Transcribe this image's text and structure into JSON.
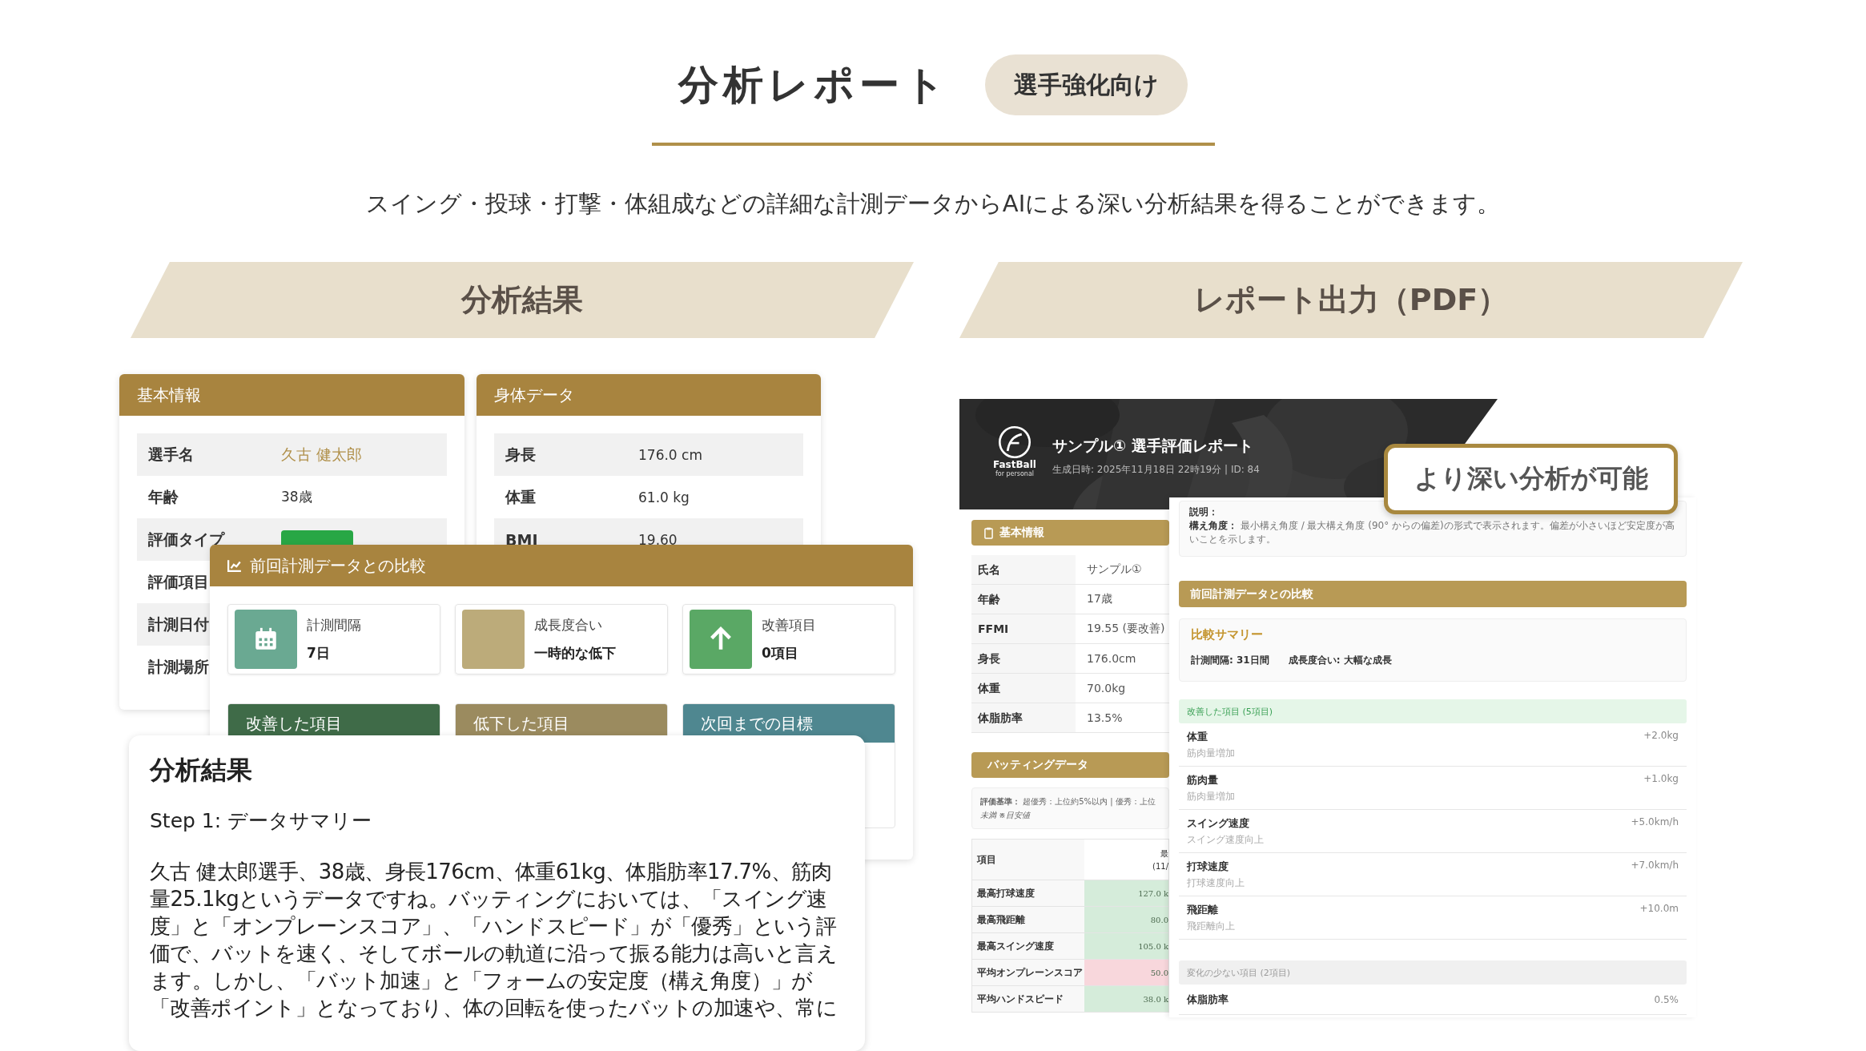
{
  "header": {
    "title": "分析レポート",
    "badge": "選手強化向け"
  },
  "subtitle": "スイング・投球・打撃・体組成などの詳細な計測データからAIによる深い分析結果を得ることができます。",
  "sections": [
    {
      "title": "分析結果"
    },
    {
      "title": "レポート出力（PDF）"
    }
  ],
  "analysis_screen": {
    "basic_info": {
      "title": "基本情報",
      "rows": [
        {
          "label": "選手名",
          "value": "久古 健太郎",
          "kind": "accent"
        },
        {
          "label": "年齢",
          "value": "38歳",
          "kind": "text"
        },
        {
          "label": "評価タイプ",
          "kind": "tag"
        },
        {
          "label": "評価項目",
          "kind": "text"
        },
        {
          "label": "計測日付",
          "kind": "text"
        },
        {
          "label": "計測場所",
          "kind": "text"
        }
      ]
    },
    "body_data": {
      "title": "身体データ",
      "rows": [
        {
          "label": "身長",
          "value": "176.0 cm"
        },
        {
          "label": "体重",
          "value": "61.0 kg"
        },
        {
          "label": "BMI",
          "value": "19.60"
        }
      ]
    },
    "comparison": {
      "title": "前回計測データとの比較",
      "stats": [
        {
          "label": "計測間隔",
          "value": "7日",
          "kind": "calendar",
          "color": "#6aa992"
        },
        {
          "label": "成長度合い",
          "value": "一時的な低下",
          "kind": "blank",
          "color": "#bcab7a"
        },
        {
          "label": "改善項目",
          "value": "0項目",
          "kind": "arrow-up",
          "color": "#5aa865"
        }
      ],
      "columns": [
        {
          "title": "改善した項目",
          "color": "#3f6b48"
        },
        {
          "title": "低下した項目",
          "color": "#9b8b5f"
        },
        {
          "title": "次回までの目標",
          "color": "#4f8790"
        }
      ]
    },
    "result": {
      "title": "分析結果",
      "step": "Step 1: データサマリー",
      "body": "久古 健太郎選手、38歳、身長176cm、体重61kg、体脂肪率17.7%、筋肉量25.1kgというデータですね。バッティングにおいては、「スイング速度」と「オンプレーンスコア」、「ハンドスピード」が「優秀」という評価で、バットを速く、そしてボールの軌道に沿って振る能力は高いと言えます。しかし、「バット加速」と「フォームの安定度（構え角度）」が「改善ポイント」となっており、体の回転を使ったバットの加速や、常に"
    }
  },
  "report_pdf": {
    "header": {
      "logo_name": "FastBall",
      "logo_sub": "for personal",
      "title": "サンプル① 選手評価レポート",
      "meta": "生成日時: 2025年11月18日 22時19分 | ID: 84"
    },
    "basic_info": {
      "title": "基本情報",
      "rows": [
        {
          "label": "氏名",
          "value": "サンプル①"
        },
        {
          "label": "年齢",
          "value": "17歳"
        },
        {
          "label": "FFMI",
          "value": "19.55 (要改善)"
        },
        {
          "label": "身長",
          "value": "176.0cm"
        },
        {
          "label": "体重",
          "value": "70.0kg"
        },
        {
          "label": "体脂肪率",
          "value": "13.5%"
        }
      ]
    },
    "batting": {
      "title": "バッティングデータ",
      "criteria": "**評価基準：** 超優秀：上位約5%以内 | 優秀：上位",
      "criteria_note": "未満 ※目安値",
      "columns": [
        {
          "label": "項目"
        },
        {
          "label": "最",
          "sub": "(11/"
        }
      ],
      "rows": [
        {
          "item": "最高打球速度",
          "value": "127.0 k",
          "color": "#d5ecda"
        },
        {
          "item": "最高飛距離",
          "value": "80.0",
          "color": "#d5ecda"
        },
        {
          "item": "最高スイング速度",
          "value": "105.0 k",
          "color": "#d5ecda"
        },
        {
          "item": "平均オンプレーンスコア",
          "value": "50.0",
          "color": "#f8d7dc"
        },
        {
          "item": "平均ハンドスピード",
          "value": "38.0 k",
          "color": "#d5ecda"
        }
      ]
    },
    "note": {
      "label": "説明：",
      "text": "**構え角度：** 最小構え角度 / 最大構え角度 (90° からの偏差)の形式で表示されます。偏差が小さいほど安定度が高いことを示します。"
    },
    "comparison": {
      "title": "前回計測データとの比較",
      "summary_title": "比較サマリー",
      "interval": "計測間隔: 31日間",
      "growth": "成長度合い: 大幅な成長",
      "improved_title": "改善した項目 (5項目)",
      "improved": [
        {
          "name": "体重",
          "value": "+2.0kg",
          "desc": "筋肉量増加"
        },
        {
          "name": "筋肉量",
          "value": "+1.0kg",
          "desc": "筋肉量増加"
        },
        {
          "name": "スイング速度",
          "value": "+5.0km/h",
          "desc": "スイング速度向上"
        },
        {
          "name": "打球速度",
          "value": "+7.0km/h",
          "desc": "打球速度向上"
        },
        {
          "name": "飛距離",
          "value": "+10.0m",
          "desc": "飛距離向上"
        }
      ],
      "stable_title": "変化の少ない項目 (2項目)",
      "stable": [
        {
          "name": "体脂肪率",
          "value": "0.5%"
        }
      ]
    }
  },
  "callout": "より深い分析が可能"
}
